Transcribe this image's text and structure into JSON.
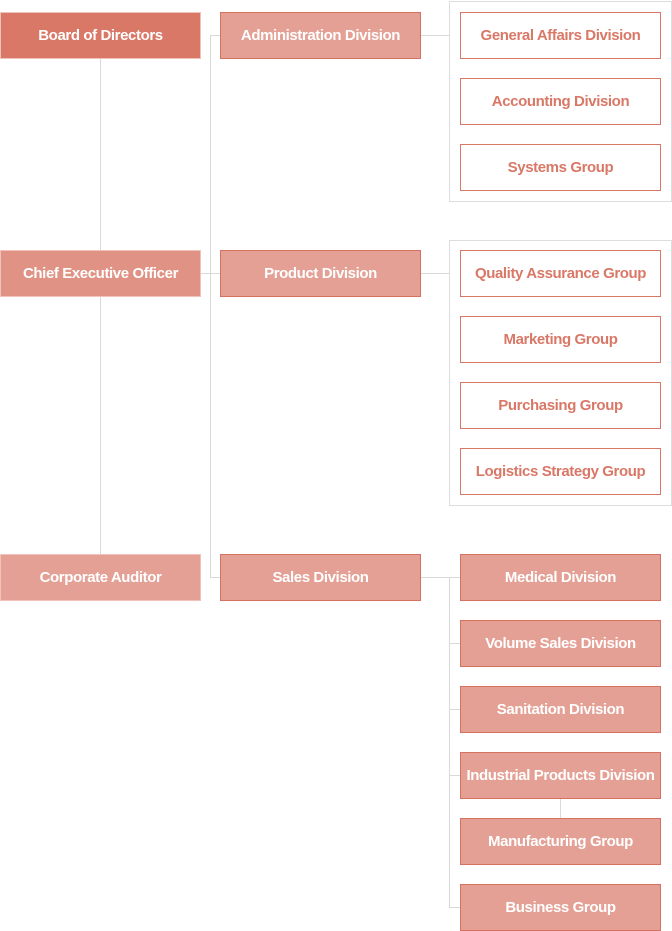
{
  "executive": {
    "board": "Board of Directors",
    "ceo": "Chief Executive Officer",
    "auditor": "Corporate Auditor"
  },
  "divisions": {
    "administration": {
      "label": "Administration Division",
      "children": [
        "General Affairs Division",
        "Accounting Division",
        "Systems Group"
      ]
    },
    "product": {
      "label": "Product Division",
      "children": [
        "Quality Assurance Group",
        "Marketing Group",
        "Purchasing Group",
        "Logistics Strategy Group"
      ]
    },
    "sales": {
      "label": "Sales Division",
      "children": [
        "Medical Division",
        "Volume Sales Division",
        "Sanitation Division",
        "Industrial Products Division",
        "Manufacturing Group",
        "Business Group"
      ]
    }
  },
  "colors": {
    "board": "#d97867",
    "ceo": "#e09385",
    "division_fill": "#e4a095",
    "accent_text": "#d97867",
    "connector": "#d9d9d9"
  }
}
